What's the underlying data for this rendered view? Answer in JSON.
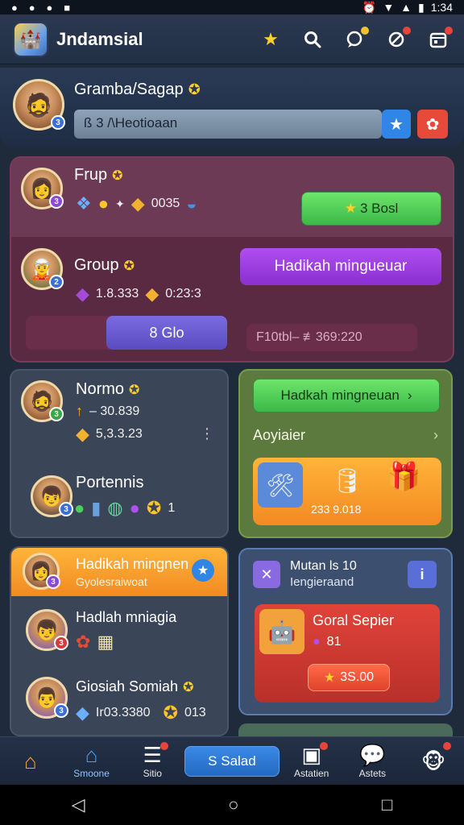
{
  "status_bar": {
    "left_icons": [
      "●",
      "●",
      "●",
      "■"
    ],
    "time": "1:34"
  },
  "app_bar": {
    "title": "Jndamsial"
  },
  "profile": {
    "name": "Gramba/Sagap",
    "level": "3",
    "input_value": "ß 3 /\\Heotioaan"
  },
  "group_panel": {
    "row1": {
      "name": "Frup",
      "level": "3",
      "value": "0035",
      "button": "3 Bosl"
    },
    "row2": {
      "name": "Group",
      "level": "2",
      "value1": "1.8.333",
      "value2": "0:23:3",
      "button": "Hadikah mingueuar"
    },
    "button_small": "8 Glo",
    "field": "F10tbl– ≢369:220"
  },
  "slate_panel": {
    "row1": {
      "name": "Normo",
      "sub_value": "– 30.839",
      "value": "5,3.3.23",
      "level": "3"
    },
    "row2": {
      "name": "Portennis",
      "level": "3",
      "count": "1"
    }
  },
  "olive_panel": {
    "button": "Hadkah mingneuan",
    "label": "Aoyiaier",
    "card_value": "233 9.018"
  },
  "left_bottom_panel": {
    "header_title": "Hadikah mingnen",
    "header_subtitle": "Gyolesraiwoat",
    "row1_name": "Hadlah mniagia",
    "row2_name": "Giosiah Somiah",
    "row2_value1": "Ir03.3380",
    "row2_value2": "013",
    "levels": [
      "3",
      "3",
      "3"
    ]
  },
  "blue_panel": {
    "title": "Mutan ls 10",
    "subtitle": "Iengieraand",
    "card_title": "Goral Sepier",
    "card_value": "81",
    "card_button": "3S.00"
  },
  "bottom_nav": {
    "items": [
      {
        "label": "",
        "icon": "home-orange-icon"
      },
      {
        "label": "Smoone",
        "icon": "home-icon"
      },
      {
        "label": "Sitio",
        "icon": "list-icon"
      },
      {
        "label": "S Salad",
        "icon": ""
      },
      {
        "label": "Astatien",
        "icon": "clipboard-icon"
      },
      {
        "label": "Astets",
        "icon": "chat-icon"
      },
      {
        "label": "",
        "icon": "avatar-icon"
      }
    ]
  },
  "colors": {
    "background": "#1f2a3b",
    "purple_panel": "#5a2a43",
    "olive_panel": "#5d7a3e",
    "accent_blue": "#2f86e6",
    "accent_green": "#3cb84a"
  }
}
